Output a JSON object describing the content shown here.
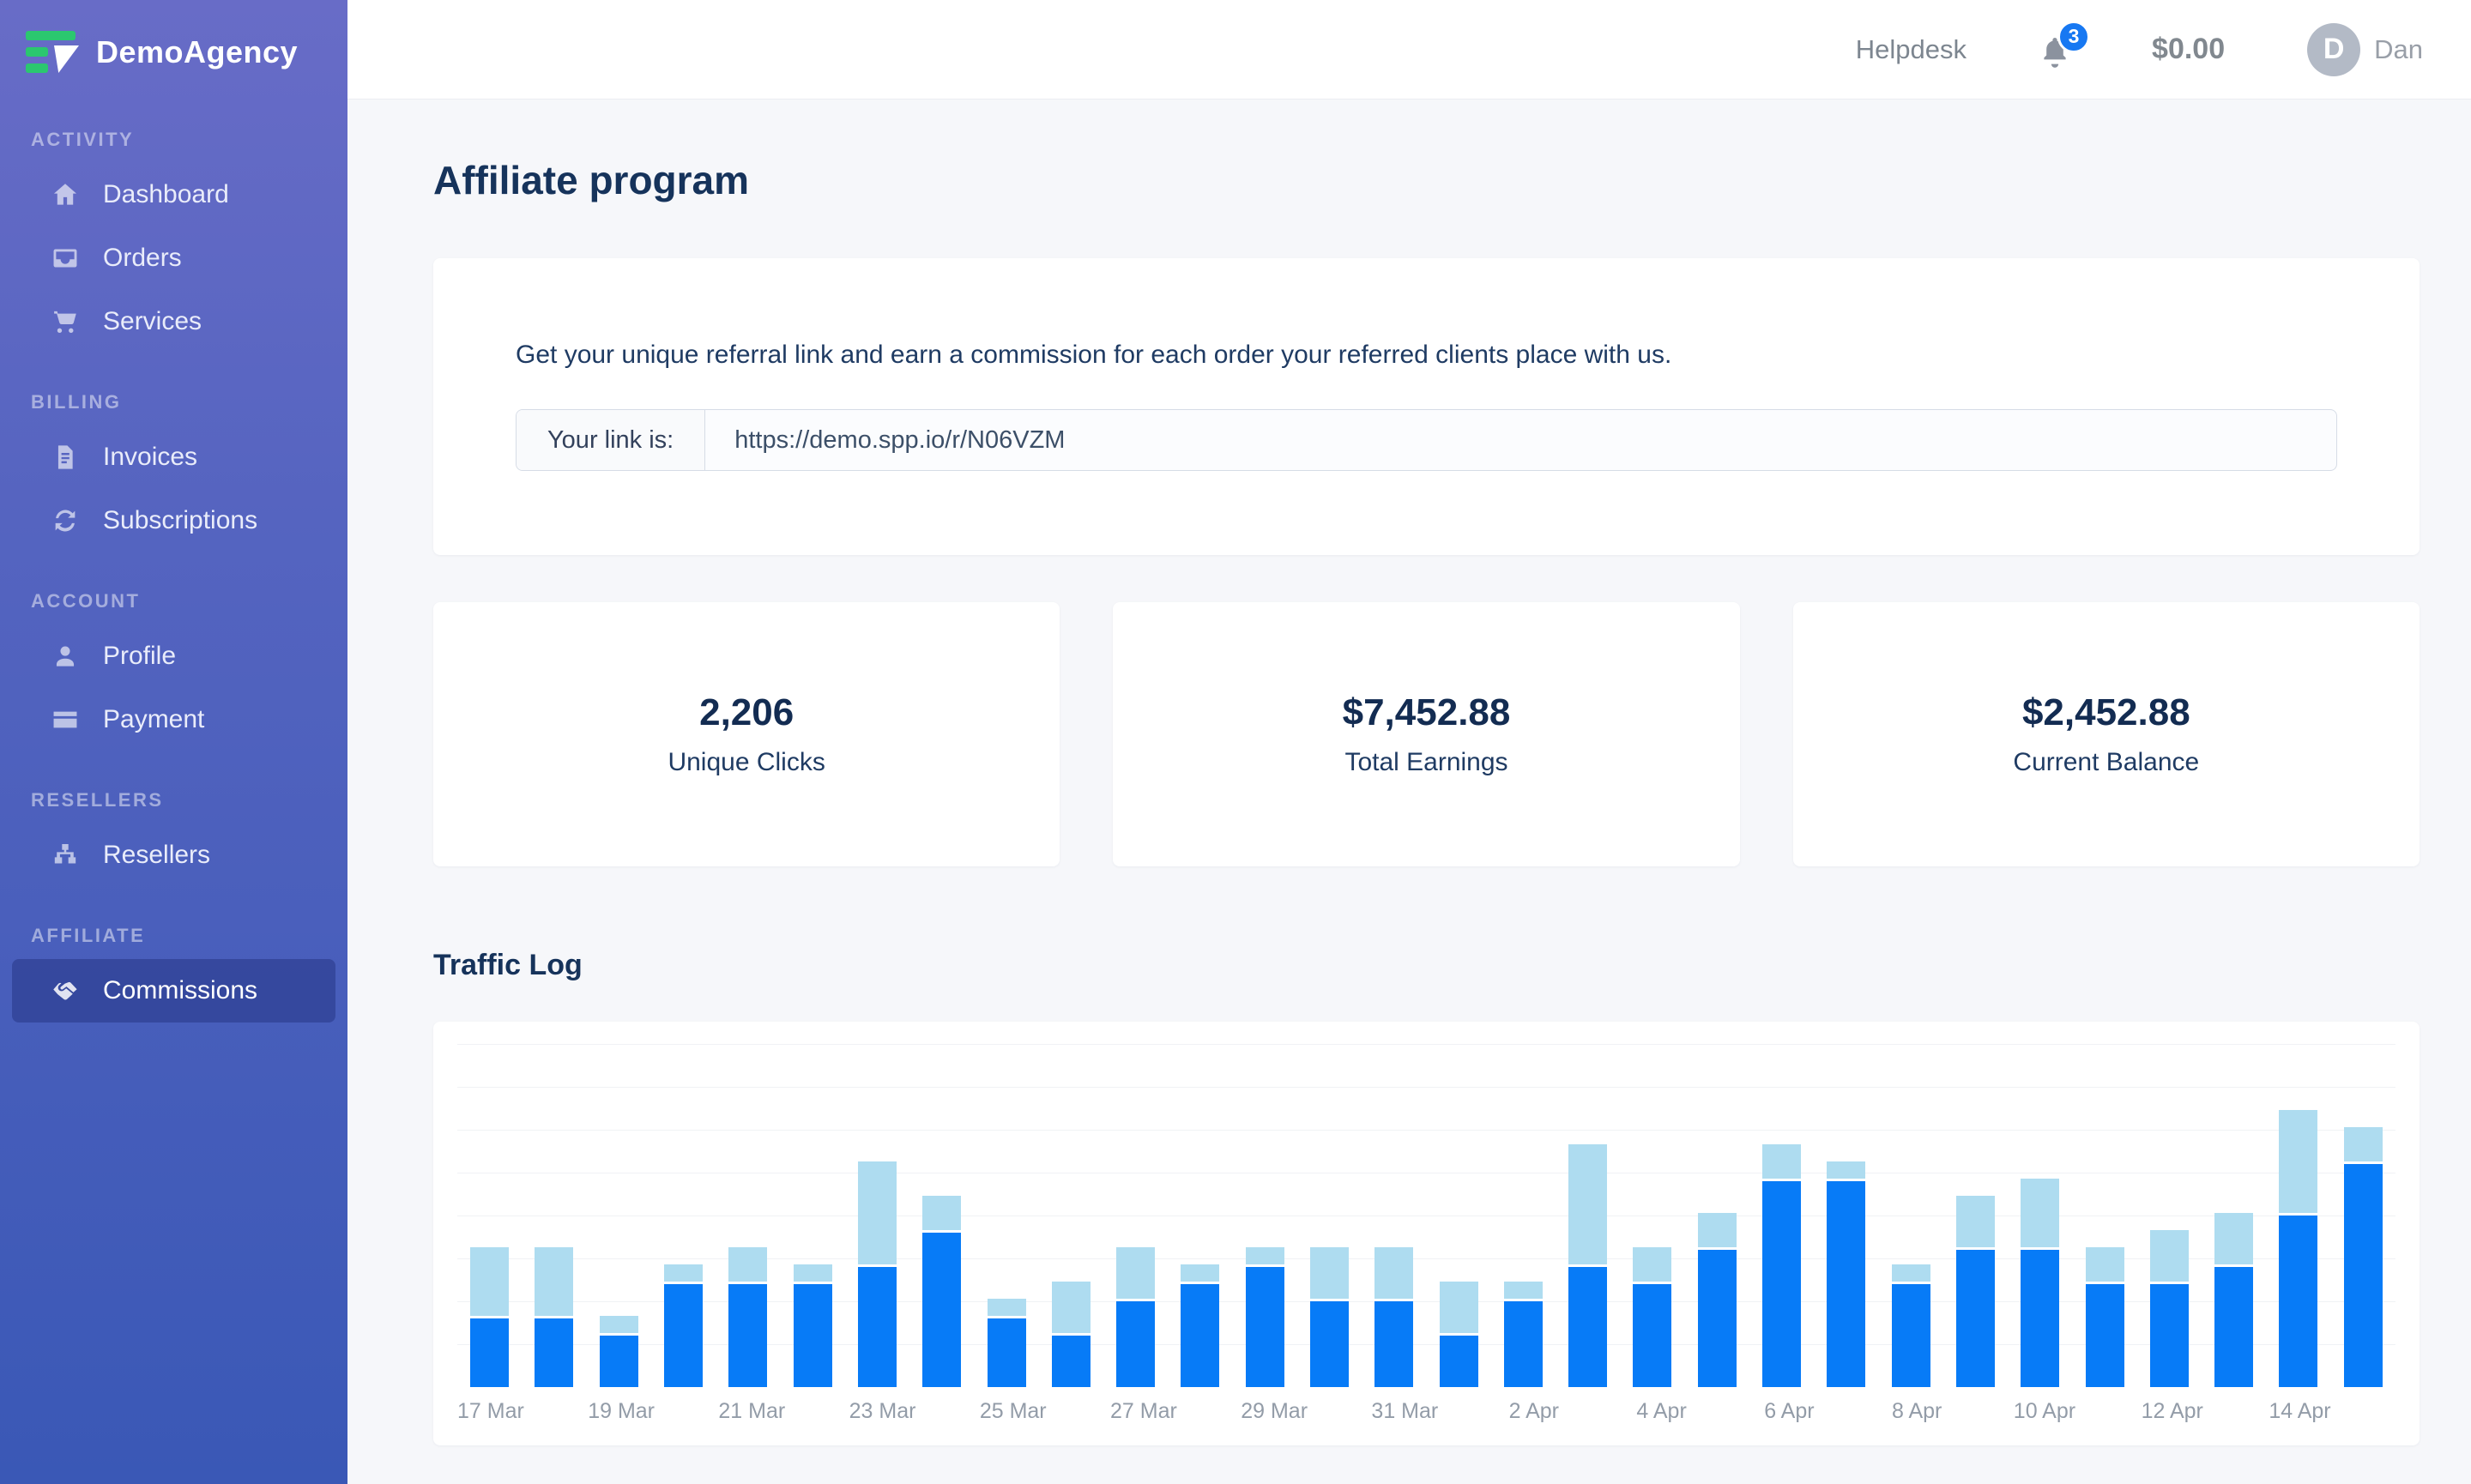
{
  "colors": {
    "sidebar_top": "#686cc7",
    "sidebar_bottom": "#3a58b6",
    "logo_green": "#2bc76f",
    "badge_blue": "#1778f2",
    "bar_dark_blue": "#077bf7",
    "bar_light_blue": "#aedcf0",
    "heading_navy": "#16335b"
  },
  "sidebar": {
    "brand": "DemoAgency",
    "sections": [
      {
        "label": "Activity",
        "items": [
          {
            "icon": "home-icon",
            "label": "Dashboard",
            "active": false
          },
          {
            "icon": "inbox-icon",
            "label": "Orders",
            "active": false
          },
          {
            "icon": "cart-icon",
            "label": "Services",
            "active": false
          }
        ]
      },
      {
        "label": "Billing",
        "items": [
          {
            "icon": "invoice-icon",
            "label": "Invoices",
            "active": false
          },
          {
            "icon": "refresh-icon",
            "label": "Subscriptions",
            "active": false
          }
        ]
      },
      {
        "label": "Account",
        "items": [
          {
            "icon": "user-icon",
            "label": "Profile",
            "active": false
          },
          {
            "icon": "credit-card-icon",
            "label": "Payment",
            "active": false
          }
        ]
      },
      {
        "label": "Resellers",
        "items": [
          {
            "icon": "sitemap-icon",
            "label": "Resellers",
            "active": false
          }
        ]
      },
      {
        "label": "Affiliate",
        "items": [
          {
            "icon": "handshake-icon",
            "label": "Commissions",
            "active": true
          }
        ]
      }
    ]
  },
  "header": {
    "helpdesk_label": "Helpdesk",
    "notification_count": "3",
    "balance": "$0.00",
    "user_initial": "D",
    "user_name": "Dan"
  },
  "page": {
    "title": "Affiliate program",
    "referral": {
      "description": "Get your unique referral link and earn a commission for each order your referred clients place with us.",
      "link_label": "Your link is:",
      "link_value": "https://demo.spp.io/r/N06VZM"
    },
    "stats": [
      {
        "value": "2,206",
        "label": "Unique Clicks"
      },
      {
        "value": "$7,452.88",
        "label": "Total Earnings"
      },
      {
        "value": "$2,452.88",
        "label": "Current Balance"
      }
    ],
    "traffic_title": "Traffic Log"
  },
  "chart_data": {
    "type": "bar",
    "stacked": true,
    "title": "Traffic Log",
    "legend_position": "none",
    "grid": "horizontal",
    "ylim": [
      0,
      40
    ],
    "gridline_step": 5,
    "categories": [
      "17 Mar",
      "18 Mar",
      "19 Mar",
      "20 Mar",
      "21 Mar",
      "22 Mar",
      "23 Mar",
      "24 Mar",
      "25 Mar",
      "26 Mar",
      "27 Mar",
      "28 Mar",
      "29 Mar",
      "30 Mar",
      "31 Mar",
      "1 Apr",
      "2 Apr",
      "3 Apr",
      "4 Apr",
      "5 Apr",
      "6 Apr",
      "7 Apr",
      "8 Apr",
      "9 Apr",
      "10 Apr",
      "11 Apr",
      "12 Apr",
      "13 Apr",
      "14 Apr",
      "15 Apr"
    ],
    "x_tick_labels": [
      "17 Mar",
      "19 Mar",
      "21 Mar",
      "23 Mar",
      "25 Mar",
      "27 Mar",
      "29 Mar",
      "31 Mar",
      "2 Apr",
      "4 Apr",
      "6 Apr",
      "8 Apr",
      "10 Apr",
      "12 Apr",
      "14 Apr"
    ],
    "series": [
      {
        "name": "clicks-dark-blue",
        "color": "#077bf7",
        "values": [
          8,
          8,
          6,
          12,
          12,
          12,
          14,
          18,
          8,
          6,
          10,
          12,
          14,
          10,
          10,
          6,
          10,
          14,
          12,
          16,
          24,
          24,
          12,
          16,
          16,
          12,
          12,
          14,
          20,
          26
        ]
      },
      {
        "name": "clicks-light-blue",
        "color": "#aedcf0",
        "values": [
          8,
          8,
          2,
          2,
          4,
          2,
          12,
          4,
          2,
          6,
          6,
          2,
          2,
          6,
          6,
          6,
          2,
          14,
          4,
          4,
          4,
          2,
          2,
          6,
          8,
          4,
          6,
          6,
          12,
          4
        ]
      }
    ]
  }
}
